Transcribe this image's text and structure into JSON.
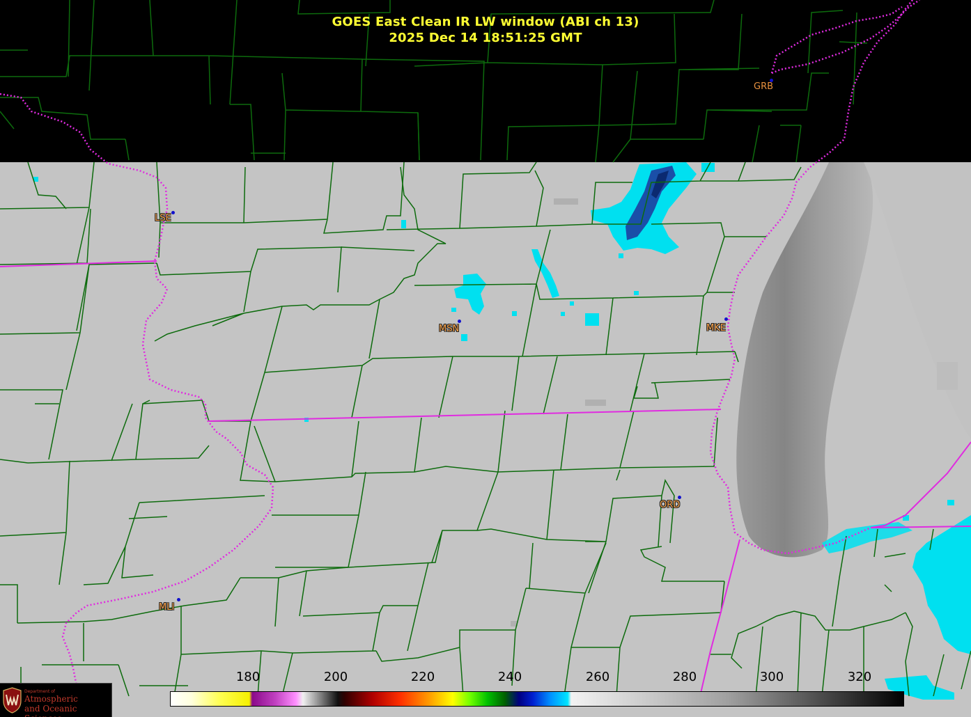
{
  "title": {
    "line1": "GOES East Clean IR LW window (ABI ch 13)",
    "line2": "2025 Dec 14  18:51:25 GMT"
  },
  "stations": [
    {
      "id": "GRB",
      "style": "plain"
    },
    {
      "id": "LSE",
      "style": "outlined"
    },
    {
      "id": "MSN",
      "style": "outlined"
    },
    {
      "id": "MKE",
      "style": "outlined"
    },
    {
      "id": "ORD",
      "style": "outlined"
    },
    {
      "id": "MLI",
      "style": "outlined"
    }
  ],
  "colorbar": {
    "ticks": [
      "180",
      "200",
      "220",
      "240",
      "260",
      "280",
      "300",
      "320"
    ],
    "min": 163,
    "max": 330
  },
  "logo": {
    "dept": "Department of",
    "line1": "Atmospheric",
    "line2": "and Oceanic Sciences"
  },
  "colors": {
    "title": "#ffff33",
    "county_lines": "#0d6b0d",
    "state_lines": "#e02be0",
    "cloud_cyan": "#00e5f0",
    "cloud_blue": "#1040a0",
    "land": "#c4c4c4",
    "lake": "#8c8c8c"
  }
}
